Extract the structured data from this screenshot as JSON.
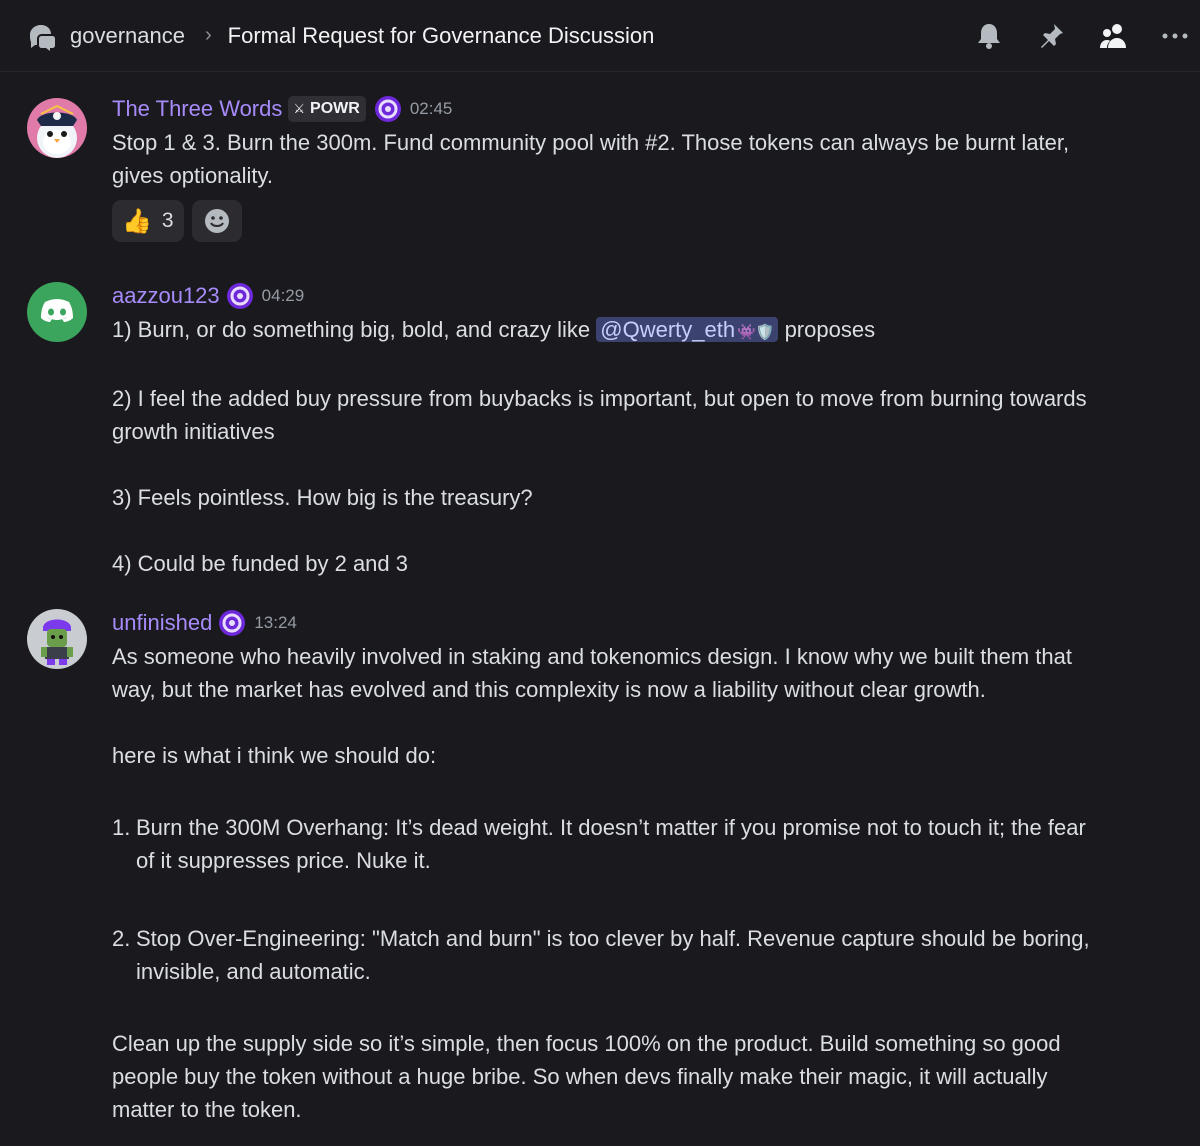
{
  "header": {
    "channel": "governance",
    "separator": "›",
    "thread_title": "Formal Request for Governance Discussion",
    "icons": [
      "threads-icon",
      "bell-icon",
      "pin-icon",
      "members-icon",
      "more-icon"
    ]
  },
  "messages": [
    {
      "username": "The Three Words",
      "tag": "POWR",
      "tag_icon": "sword-icon",
      "time": "02:45",
      "lines": [
        "Stop 1 & 3. Burn the 300m. Fund community pool with #2. Those tokens can always be burnt later,",
        "gives optionality."
      ],
      "reactions": [
        {
          "emoji": "👍",
          "count": "3"
        }
      ]
    },
    {
      "username": "aazzou123",
      "time": "04:29",
      "line1_before": "1) Burn, or do something big, bold, and crazy like ",
      "mention": "@Qwerty_eth",
      "mention_emojis": "👾🛡️",
      "line1_after": " proposes",
      "p2_line1": "2) I feel the added buy pressure from buybacks is important, but open to move from burning towards",
      "p2_line2": "growth initiatives",
      "p3": "3) Feels pointless. How big is the treasury?",
      "p4": "4) Could be funded by 2 and 3"
    },
    {
      "username": "unfinished",
      "time": "13:24",
      "p1_line1": "As someone who heavily involved in staking and tokenomics design. I know why we built them that",
      "p1_line2": "way, but the market has evolved and this complexity is now a liability without clear growth.",
      "p2": "here is what i think we should do:",
      "list": [
        {
          "num": "1.",
          "line1": "Burn the 300M Overhang: It’s dead weight. It doesn’t matter if you promise not to touch it; the fear",
          "line2": "of it suppresses price. Nuke it."
        },
        {
          "num": "2.",
          "line1": "Stop Over-Engineering: \"Match and burn\" is too clever by half. Revenue capture should be boring,",
          "line2": "invisible, and automatic."
        }
      ],
      "p3_line1": "Clean up the supply side so it’s simple, then focus 100% on the product. Build something so good",
      "p3_line2": "people buy the token without a huge bribe. So when devs finally make their magic, it will actually",
      "p3_line3": "matter to the token."
    }
  ],
  "colors": {
    "background": "#1a1a1e",
    "username": "#a78bfa",
    "text": "#dbdee1",
    "timestamp": "#949ba4",
    "mention_bg": "#3c4270"
  }
}
